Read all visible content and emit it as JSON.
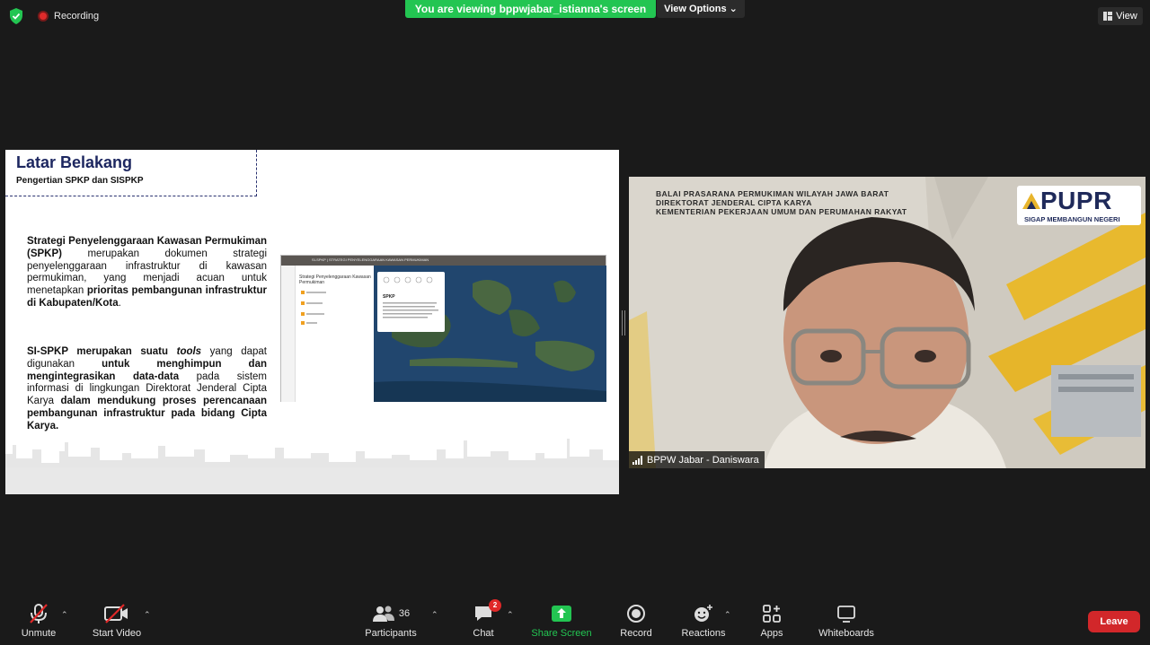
{
  "top_bar": {
    "recording_label": "Recording",
    "sharing_banner": "You are viewing bppwjabar_istianna's screen",
    "view_options_label": "View Options",
    "view_label": "View"
  },
  "slide": {
    "title": "Latar Belakang",
    "subtitle": "Pengertian SPKP dan SISPKP",
    "para1_bold1": "Strategi Penyelenggaraan Kawasan Permukiman (SPKP)",
    "para1_text1": " merupakan dokumen strategi penyelenggaraan infrastruktur di kawasan permukiman, yang menjadi acuan untuk menetapkan ",
    "para1_bold2": "prioritas pembangunan infrastruktur di Kabupaten/Kota",
    "para1_text2": ".",
    "para2_bold1": "SI-SPKP merupakan suatu ",
    "para2_italic": "tools",
    "para2_text1": " yang dapat digunakan ",
    "para2_bold2": "untuk menghimpun dan mengintegrasikan data-data",
    "para2_text2": " pada sistem informasi di lingkungan Direktorat Jenderal Cipta Karya ",
    "para2_bold3": "dalam mendukung proses perencanaan pembangunan infrastruktur pada bidang Cipta Karya.",
    "app_top_title": "SI-SPKP | STRATEGI PENYELENGGARAAN KAWASAN PERMUKIMAN",
    "app_panel_title": "Strategi Penyelenggaraan Kawasan Permukiman",
    "app_popup_title": "SPKP"
  },
  "video": {
    "header_line1": "BALAI PRASARANA PERMUKIMAN WILAYAH JAWA BARAT",
    "header_line2": "DIREKTORAT JENDERAL CIPTA KARYA",
    "header_line3": "KEMENTERIAN PEKERJAAN UMUM DAN PERUMAHAN RAKYAT",
    "logo_text": "PUPR",
    "logo_tagline": "SIGAP MEMBANGUN NEGERI",
    "participant_name": "BPPW Jabar - Daniswara"
  },
  "toolbar": {
    "unmute": "Unmute",
    "start_video": "Start Video",
    "participants": "Participants",
    "participants_count": "36",
    "chat": "Chat",
    "chat_badge": "2",
    "share_screen": "Share Screen",
    "record": "Record",
    "reactions": "Reactions",
    "apps": "Apps",
    "whiteboards": "Whiteboards",
    "leave": "Leave"
  },
  "colors": {
    "share_green": "#23c552",
    "leave_red": "#d2272a",
    "slide_title_navy": "#1d2760"
  }
}
